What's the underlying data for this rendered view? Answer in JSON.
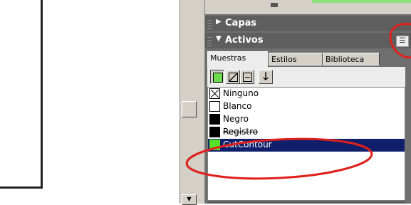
{
  "panels": {
    "capas": {
      "title": "Capas",
      "state": "collapsed"
    },
    "activos": {
      "title": "Activos",
      "state": "expanded",
      "menu_icon": "panel-menu-icon"
    }
  },
  "tabs": [
    {
      "label": "Muestras",
      "active": true
    },
    {
      "label": "Estilos",
      "active": false
    },
    {
      "label": "Biblioteca",
      "active": false
    }
  ],
  "toolbar": {
    "fill_swatch_color": "#6cde4c",
    "icons": [
      "fill-icon",
      "stroke-icon",
      "text-icon",
      "arrow-down-icon"
    ]
  },
  "swatches": [
    {
      "name": "Ninguno",
      "color": "none",
      "selected": false
    },
    {
      "name": "Blanco",
      "color": "#ffffff",
      "selected": false
    },
    {
      "name": "Negro",
      "color": "#000000",
      "selected": false
    },
    {
      "name": "Registro",
      "color": "#000000",
      "selected": false
    },
    {
      "name": "CutContour",
      "color": "#55e02a",
      "selected": true
    }
  ],
  "colors": {
    "selection": "#0f1f6b",
    "annotation": "#e0201c",
    "panel_bg": "#5e5e5e"
  }
}
